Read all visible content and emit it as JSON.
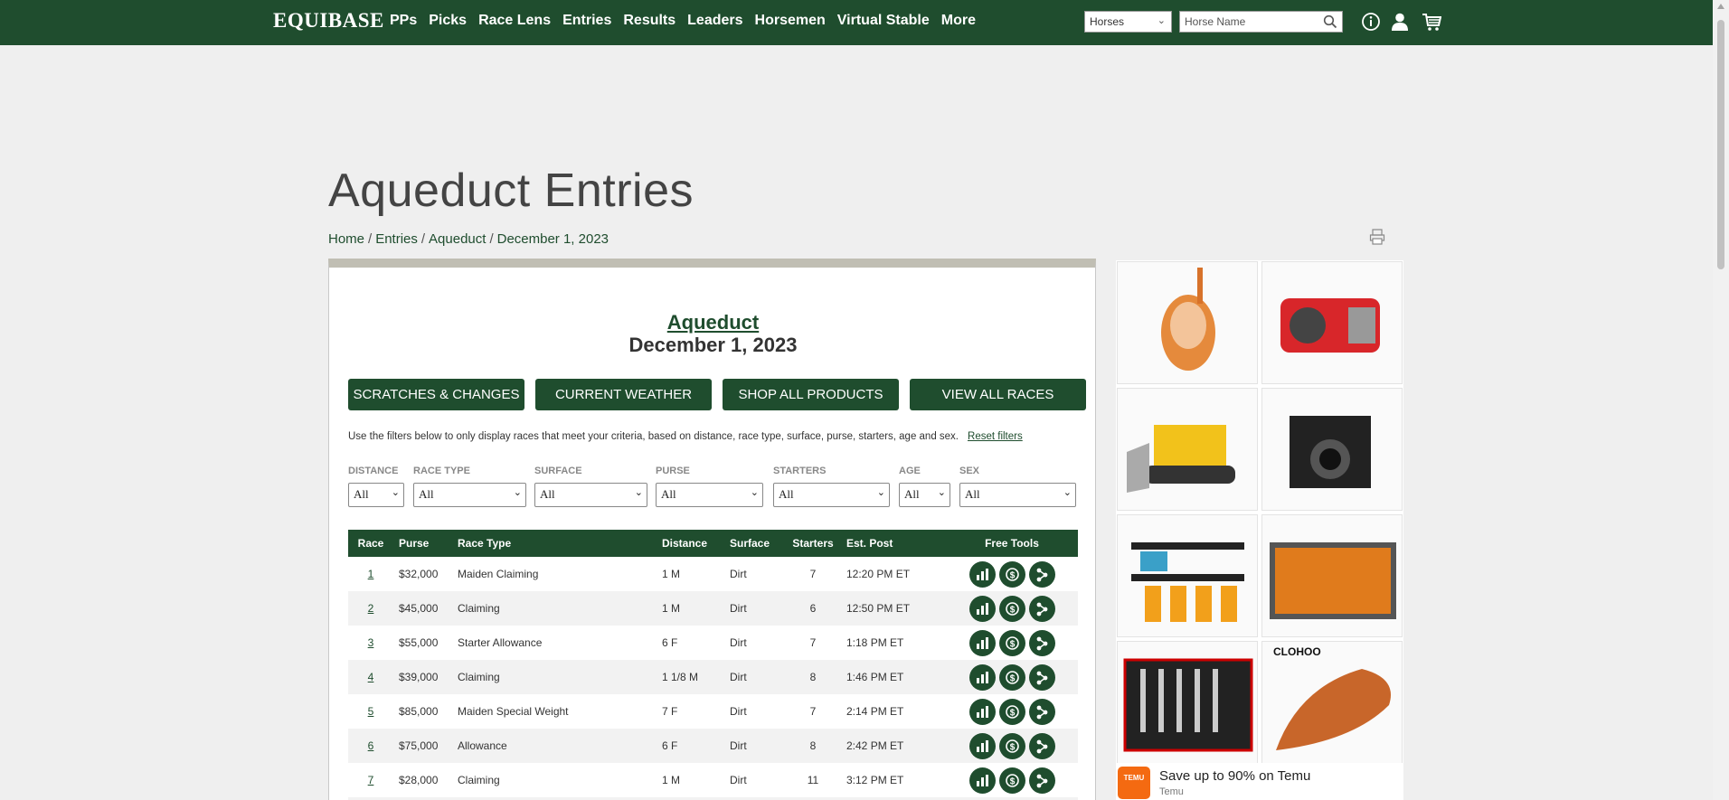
{
  "header": {
    "logo": "EQUIBASE",
    "nav": [
      "PPs",
      "Picks",
      "Race Lens",
      "Entries",
      "Results",
      "Leaders",
      "Horsemen",
      "Virtual Stable",
      "More"
    ],
    "search_type": "Horses",
    "search_placeholder": "Horse Name"
  },
  "page": {
    "title": "Aqueduct Entries",
    "breadcrumb": [
      "Home",
      "Entries",
      "Aqueduct",
      "December 1, 2023"
    ]
  },
  "card": {
    "track": "Aqueduct",
    "date": "December 1, 2023",
    "buttons": [
      "SCRATCHES & CHANGES",
      "CURRENT WEATHER",
      "SHOP ALL PRODUCTS",
      "VIEW ALL RACES"
    ],
    "filter_note": "Use the filters below to only display races that meet your criteria, based on distance, race type, surface, purse, starters, age and sex.",
    "reset_label": "Reset filters",
    "filters": [
      {
        "label": "DISTANCE",
        "value": "All"
      },
      {
        "label": "RACE TYPE",
        "value": "All"
      },
      {
        "label": "SURFACE",
        "value": "All"
      },
      {
        "label": "PURSE",
        "value": "All"
      },
      {
        "label": "STARTERS",
        "value": "All"
      },
      {
        "label": "AGE",
        "value": "All"
      },
      {
        "label": "SEX",
        "value": "All"
      }
    ]
  },
  "table": {
    "columns": [
      "Race",
      "Purse",
      "Race Type",
      "Distance",
      "Surface",
      "Starters",
      "Est. Post",
      "Free Tools"
    ],
    "rows": [
      {
        "race": "1",
        "purse": "$32,000",
        "type": "Maiden Claiming",
        "distance": "1 M",
        "surface": "Dirt",
        "starters": "7",
        "post": "12:20 PM ET"
      },
      {
        "race": "2",
        "purse": "$45,000",
        "type": "Claiming",
        "distance": "1 M",
        "surface": "Dirt",
        "starters": "6",
        "post": "12:50 PM ET"
      },
      {
        "race": "3",
        "purse": "$55,000",
        "type": "Starter Allowance",
        "distance": "6 F",
        "surface": "Dirt",
        "starters": "7",
        "post": "1:18 PM ET"
      },
      {
        "race": "4",
        "purse": "$39,000",
        "type": "Claiming",
        "distance": "1 1/8 M",
        "surface": "Dirt",
        "starters": "8",
        "post": "1:46 PM ET"
      },
      {
        "race": "5",
        "purse": "$85,000",
        "type": "Maiden Special Weight",
        "distance": "7 F",
        "surface": "Dirt",
        "starters": "7",
        "post": "2:14 PM ET"
      },
      {
        "race": "6",
        "purse": "$75,000",
        "type": "Allowance",
        "distance": "6 F",
        "surface": "Dirt",
        "starters": "8",
        "post": "2:42 PM ET"
      },
      {
        "race": "7",
        "purse": "$28,000",
        "type": "Claiming",
        "distance": "1 M",
        "surface": "Dirt",
        "starters": "11",
        "post": "3:12 PM ET"
      }
    ]
  },
  "ad": {
    "headline": "Save up to 90% on Temu",
    "brand": "Temu",
    "logo_text": "TEMU",
    "product_brand_text": "CLOHOO"
  },
  "colors": {
    "brand_green": "#1f4d2e",
    "temu_orange": "#f46a11"
  }
}
